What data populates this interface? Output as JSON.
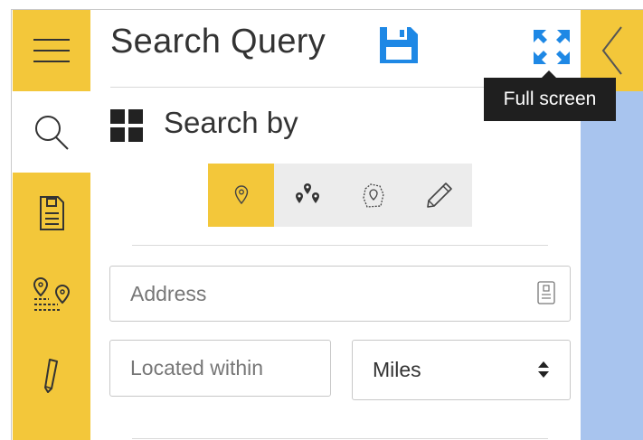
{
  "panel": {
    "title": "Search Query",
    "tooltip": "Full screen"
  },
  "search_by": {
    "label": "Search by",
    "modes": [
      {
        "icon": "map-pin-icon",
        "active": true
      },
      {
        "icon": "multi-pin-icon",
        "active": false
      },
      {
        "icon": "area-pin-icon",
        "active": false
      },
      {
        "icon": "pencil-icon",
        "active": false
      }
    ]
  },
  "address": {
    "placeholder": "Address"
  },
  "distance": {
    "placeholder": "Located within"
  },
  "units": {
    "selected": "Miles"
  },
  "sidebar": {
    "items": [
      "menu-icon",
      "search-icon",
      "save-icon",
      "route-icon",
      "pencil-icon"
    ],
    "active": "search-icon"
  },
  "colors": {
    "accent": "#f3c73a",
    "map": "#a8c4ee",
    "save_blue": "#1e88e5"
  }
}
